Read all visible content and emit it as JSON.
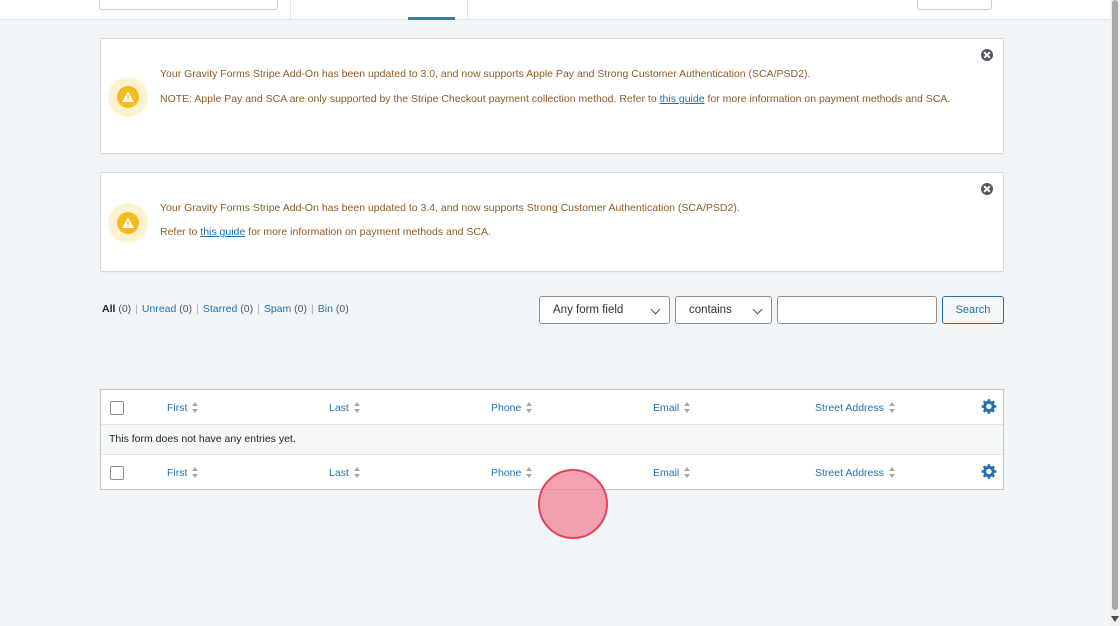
{
  "notices": [
    {
      "line1": "Your Gravity Forms Stripe Add-On has been updated to 3.0, and now supports Apple Pay and Strong Customer Authentication (SCA/PSD2).",
      "line2_before": "NOTE: Apple Pay and SCA are only supported by the Stripe Checkout payment collection method. Refer to ",
      "link": "this guide",
      "line2_after": " for more information on payment methods and SCA."
    },
    {
      "line1": "Your Gravity Forms Stripe Add-On has been updated to 3.4, and now supports Strong Customer Authentication (SCA/PSD2).",
      "line2_before": "Refer to ",
      "link": "this guide",
      "line2_after": " for more information on payment methods and SCA."
    }
  ],
  "filters": {
    "all": "All",
    "all_count": "(0)",
    "unread": "Unread",
    "unread_count": "(0)",
    "starred": "Starred",
    "starred_count": "(0)",
    "spam": "Spam",
    "spam_count": "(0)",
    "bin": "Bin",
    "bin_count": "(0)",
    "separator": "|"
  },
  "search": {
    "field_select": "Any form field",
    "operator_select": "contains",
    "input_value": "",
    "button": "Search"
  },
  "table": {
    "columns": [
      "First",
      "Last",
      "Phone",
      "Email",
      "Street Address"
    ],
    "empty_message": "This form does not have any entries yet."
  },
  "colors": {
    "link": "#2271b1",
    "notice_text": "#8b5c27",
    "warning": "#f4bc1c",
    "click_indicator": "#e2445c"
  }
}
